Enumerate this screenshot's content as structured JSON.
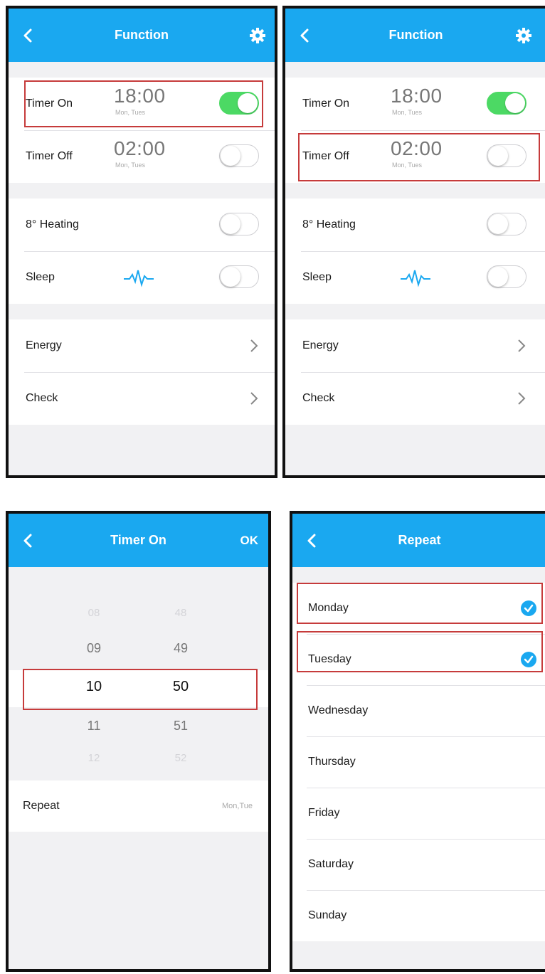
{
  "screen1": {
    "title": "Function",
    "timer_on": {
      "label": "Timer On",
      "time": "18:00",
      "days": "Mon, Tues",
      "enabled": true
    },
    "timer_off": {
      "label": "Timer Off",
      "time": "02:00",
      "days": "Mon, Tues",
      "enabled": false
    },
    "heating": {
      "label": "8° Heating",
      "enabled": false
    },
    "sleep": {
      "label": "Sleep",
      "enabled": false
    },
    "energy": {
      "label": "Energy"
    },
    "check": {
      "label": "Check"
    }
  },
  "screen2": {
    "title": "Function",
    "timer_on": {
      "label": "Timer On",
      "time": "18:00",
      "days": "Mon, Tues",
      "enabled": true
    },
    "timer_off": {
      "label": "Timer Off",
      "time": "02:00",
      "days": "Mon, Tues",
      "enabled": false
    },
    "heating": {
      "label": "8° Heating",
      "enabled": false
    },
    "sleep": {
      "label": "Sleep",
      "enabled": false
    },
    "energy": {
      "label": "Energy"
    },
    "check": {
      "label": "Check"
    }
  },
  "screen3": {
    "title": "Timer On",
    "ok_label": "OK",
    "hours": [
      "08",
      "09",
      "10",
      "11",
      "12"
    ],
    "minutes": [
      "48",
      "49",
      "50",
      "51",
      "52"
    ],
    "repeat_label": "Repeat",
    "repeat_value": "Mon,Tue"
  },
  "screen4": {
    "title": "Repeat",
    "days": [
      {
        "label": "Monday",
        "checked": true
      },
      {
        "label": "Tuesday",
        "checked": true
      },
      {
        "label": "Wednesday",
        "checked": false
      },
      {
        "label": "Thursday",
        "checked": false
      },
      {
        "label": "Friday",
        "checked": false
      },
      {
        "label": "Saturday",
        "checked": false
      },
      {
        "label": "Sunday",
        "checked": false
      }
    ]
  },
  "colors": {
    "accent": "#1aa8f0",
    "toggle_on": "#4cd964",
    "highlight": "#c63b3b"
  }
}
